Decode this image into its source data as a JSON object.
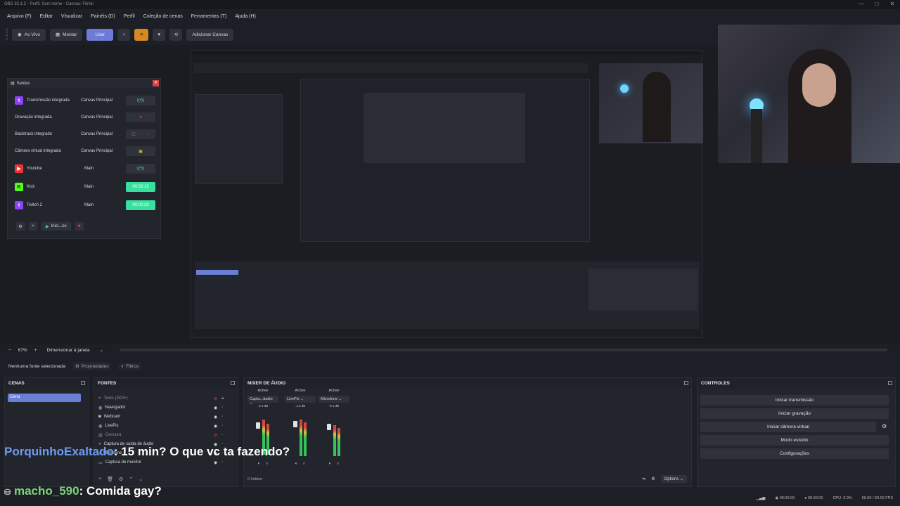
{
  "window": {
    "title": "OBS 32.1.2 - Perfil: Sem nome - Canvas: Filmin",
    "controls": [
      "—",
      "□",
      "✕"
    ]
  },
  "menu": [
    "Arquivo (F)",
    "Editar",
    "Visualizar",
    "Painéis (D)",
    "Perfil",
    "Coleção de cenas",
    "Ferramentas (T)",
    "Ajuda (H)"
  ],
  "toolbar": {
    "ao_vivo": "Ao Vivo",
    "montar": "Montar",
    "user": "User",
    "add": "+",
    "adicionar_canvas": "Adicionar Canvas"
  },
  "outputs": {
    "title": "Saídas",
    "rows": [
      {
        "name": "Transmissão integrada",
        "canvas": "Canvas Principal",
        "platform": "twitch-icon",
        "state": "idle"
      },
      {
        "name": "Gravação integrada",
        "canvas": "Canvas Principal",
        "platform": "",
        "state": "record"
      },
      {
        "name": "Backtrack integrado",
        "canvas": "Canvas Principal",
        "platform": "",
        "state": "backtrack"
      },
      {
        "name": "Câmera virtual integrada",
        "canvas": "Canvas Principal",
        "platform": "",
        "state": "camera"
      },
      {
        "name": "Youtube",
        "canvas": "Main",
        "platform": "youtube-icon",
        "state": "idle"
      },
      {
        "name": "Kick",
        "canvas": "Main",
        "platform": "kick-icon",
        "state": "live",
        "timer": "00:02:12"
      },
      {
        "name": "Twitch 2",
        "canvas": "Main",
        "platform": "twitch-icon",
        "state": "live",
        "timer": "00:02:20"
      }
    ],
    "start_label": "Inici...os"
  },
  "zoom": {
    "level": "67%",
    "mode": "Dimensionar à janela"
  },
  "props": {
    "no_source": "Nenhuma fonte selecionada",
    "properties": "Propriedades",
    "filters": "Filtros"
  },
  "scenes": {
    "title": "CENAS",
    "items": [
      "Cena"
    ]
  },
  "sources": {
    "title": "FONTES",
    "items": [
      {
        "name": "Texto (GDI+)",
        "icon": "text-icon"
      },
      {
        "name": "Navegador",
        "icon": "globe-icon"
      },
      {
        "name": "Webcam",
        "icon": "camera-icon"
      },
      {
        "name": "LivePix",
        "icon": "globe-icon"
      },
      {
        "name": "Censura",
        "icon": "image-icon"
      },
      {
        "name": "Captura de saída de áudio",
        "icon": "speaker-icon"
      },
      {
        "name": "Microfone",
        "icon": "mic-icon"
      },
      {
        "name": "Captura de monitor",
        "icon": "monitor-icon"
      }
    ]
  },
  "mixer": {
    "title": "MIXER DE ÁUDIO",
    "channels": [
      {
        "status": "Active",
        "name": "Captu...áudio",
        "db": "-2.4 dB",
        "level": 0.7
      },
      {
        "status": "Active",
        "name": "LivePix",
        "db": "-1.8 dB",
        "level": 0.72
      },
      {
        "status": "Active",
        "name": "Microfone",
        "db": "-5.1 dB",
        "level": 0.6
      }
    ],
    "scale": [
      "0",
      "-6",
      "-12",
      "-18",
      "-24",
      "-30",
      "-36",
      "-42",
      "-48",
      "-54",
      "-60"
    ],
    "hidden": "0 hidden",
    "options": "Options"
  },
  "controls": {
    "title": "CONTROLES",
    "buttons": [
      "Iniciar transmissão",
      "Iniciar gravação",
      "Iniciar câmera virtual",
      "Modo estúdio",
      "Configurações"
    ]
  },
  "status": {
    "stream_time": "00:00:00",
    "rec_time": "00:00:00",
    "cpu": "CPU: 3.0%",
    "fps": "60.00 / 60.00 FPS"
  },
  "chat": [
    {
      "user": "PorquinhoExaltado",
      "message": "15 min? O que vc ta fazendo?"
    },
    {
      "user": "macho_590",
      "message": "Comida gay?"
    }
  ]
}
